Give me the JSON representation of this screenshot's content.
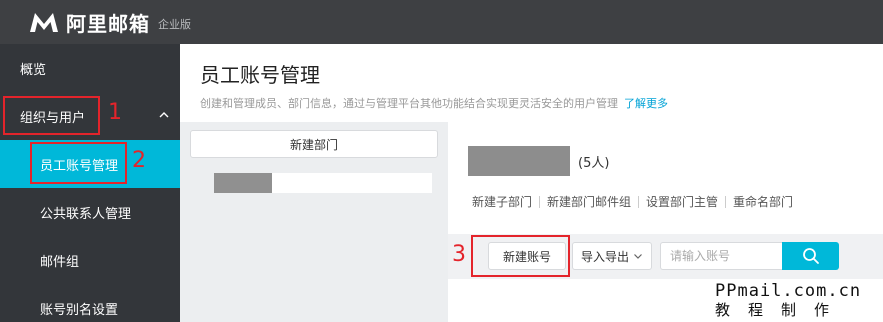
{
  "header": {
    "logo_icon": "m-logo-icon",
    "app_name": "阿里邮箱",
    "edition": "企业版"
  },
  "sidebar": {
    "items": [
      {
        "label": "概览"
      },
      {
        "label": "组织与用户",
        "expanded": true
      },
      {
        "label": "员工账号管理",
        "active": true
      },
      {
        "label": "公共联系人管理"
      },
      {
        "label": "邮件组"
      },
      {
        "label": "账号别名设置"
      }
    ],
    "expand_icon": "chevron-up-icon"
  },
  "main": {
    "title": "员工账号管理",
    "description": "创建和管理成员、部门信息，通过与管理平台其他功能结合实现更灵活安全的用户管理",
    "learn_more": "了解更多"
  },
  "tree": {
    "new_dept_label": "新建部门"
  },
  "dept": {
    "member_count": "(5人)",
    "actions": [
      "新建子部门",
      "新建部门邮件组",
      "设置部门主管",
      "重命名部门"
    ]
  },
  "toolbar": {
    "new_account_label": "新建账号",
    "import_export_label": "导入导出",
    "search_placeholder": "请输入账号",
    "search_icon": "search-icon"
  },
  "annotations": {
    "color": "#e4242b",
    "steps": [
      "1",
      "2",
      "3"
    ]
  },
  "watermark": {
    "line1": "PPmail.com.cn",
    "line2": "教程制作"
  },
  "colors": {
    "accent": "#00b8d9",
    "topbar": "#3e4043",
    "sidebar": "#33363a",
    "link": "#00a2d6"
  }
}
